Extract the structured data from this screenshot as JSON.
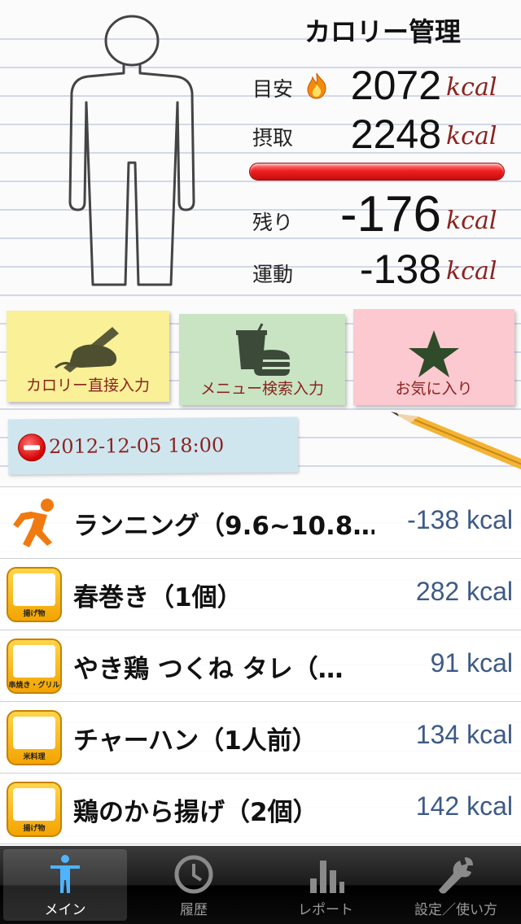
{
  "header": {
    "title": "カロリー管理"
  },
  "stats": {
    "target": {
      "label": "目安",
      "value": "2072",
      "unit": "kcal"
    },
    "intake": {
      "label": "摂取",
      "value": "2248",
      "unit": "kcal"
    },
    "remaining": {
      "label": "残り",
      "value": "-176",
      "unit": "kcal"
    },
    "exercise": {
      "label": "運動",
      "value": "-138",
      "unit": "kcal"
    },
    "progress_fraction": 1.0
  },
  "actions": [
    {
      "label": "カロリー直接入力",
      "icon": "hand-writing-icon",
      "color": "#f9f097"
    },
    {
      "label": "メニュー検索入力",
      "icon": "fast-food-icon",
      "color": "#c9e4c3"
    },
    {
      "label": "お気に入り",
      "icon": "star-icon",
      "color": "#fbc9cf"
    }
  ],
  "date_tag": "2012-12-05 18:00",
  "entries": [
    {
      "name": "ランニング（9.6~10.8…",
      "kcal": "-138 kcal",
      "icon": "running-man-icon"
    },
    {
      "name": "春巻き（1個）",
      "kcal": "282 kcal",
      "icon": "fried-food-icon",
      "category": "揚げ物"
    },
    {
      "name": "やき鶏 つくね タレ（…",
      "kcal": "91 kcal",
      "icon": "skewer-icon",
      "category": "串焼き・グリル"
    },
    {
      "name": "チャーハン（1人前）",
      "kcal": "134 kcal",
      "icon": "rice-bowl-icon",
      "category": "米料理"
    },
    {
      "name": "鶏のから揚げ（2個）",
      "kcal": "142 kcal",
      "icon": "fried-food-icon",
      "category": "揚げ物"
    }
  ],
  "tabbar": {
    "tabs": [
      {
        "label": "メイン",
        "icon": "person-icon",
        "active": true
      },
      {
        "label": "履歴",
        "icon": "clock-icon",
        "active": false
      },
      {
        "label": "レポート",
        "icon": "bar-chart-icon",
        "active": false
      },
      {
        "label": "設定／使い方",
        "icon": "wrench-icon",
        "active": false
      }
    ]
  },
  "colors": {
    "unit": "#8b2320",
    "kcal_list": "#3d5a87",
    "progress_bar": "#e01616"
  }
}
